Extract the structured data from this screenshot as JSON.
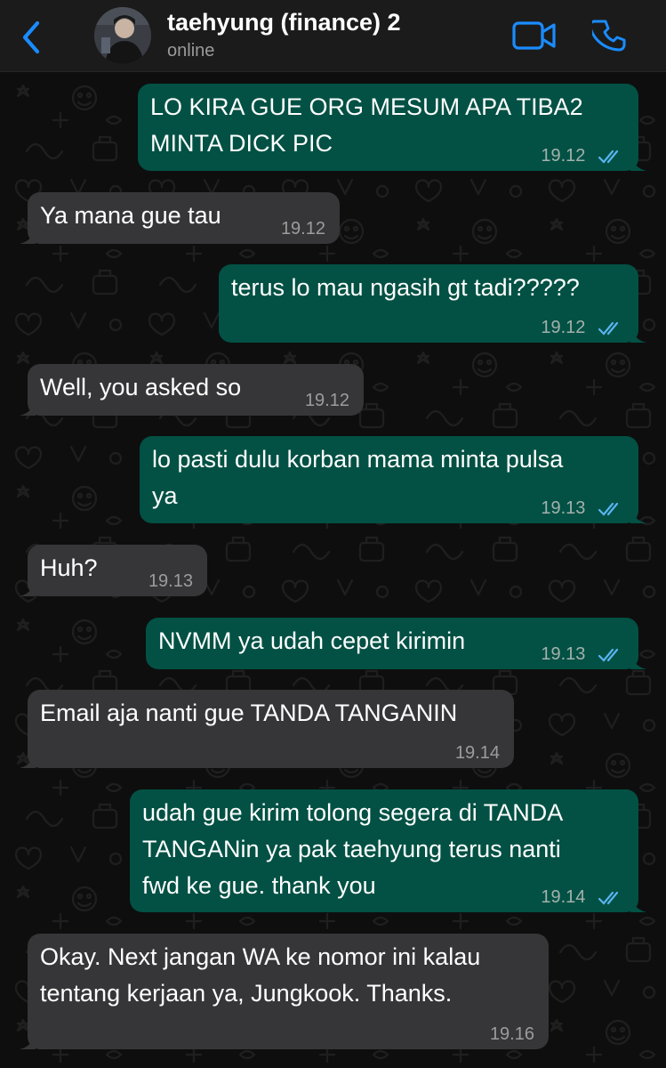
{
  "header": {
    "back_icon": "chevron-left-icon",
    "contact_name": "taehyung (finance) 2",
    "status": "online",
    "video_icon": "video-camera-icon",
    "call_icon": "phone-icon",
    "accent_color": "#1a8cff"
  },
  "messages": [
    {
      "direction": "out",
      "text": "LO KIRA GUE ORG MESUM APA TIBA2\nMINTA DICK PIC",
      "time": "19.12",
      "read": true
    },
    {
      "direction": "in",
      "text": "Ya mana gue tau",
      "time": "19.12"
    },
    {
      "direction": "out",
      "text": "terus lo mau ngasih gt tadi?????",
      "time": "19.12",
      "read": true
    },
    {
      "direction": "in",
      "text": "Well, you asked so",
      "time": "19.12"
    },
    {
      "direction": "out",
      "text": "lo pasti dulu korban mama minta pulsa\nya",
      "time": "19.13",
      "read": true
    },
    {
      "direction": "in",
      "text": "Huh?",
      "time": "19.13"
    },
    {
      "direction": "out",
      "text": "NVMM ya udah cepet kirimin",
      "time": "19.13",
      "read": true
    },
    {
      "direction": "in",
      "text": "Email aja nanti gue TANDA TANGANIN",
      "time": "19.14"
    },
    {
      "direction": "out",
      "text": "udah gue kirim tolong segera di TANDA\nTANGANin ya pak taehyung terus nanti\nfwd ke gue. thank you",
      "time": "19.14",
      "read": true
    },
    {
      "direction": "in",
      "text": "Okay. Next jangan WA ke nomor ini kalau\ntentang kerjaan ya, Jungkook. Thanks.",
      "time": "19.16"
    }
  ],
  "colors": {
    "outgoing_bubble": "#025144",
    "incoming_bubble": "#363638",
    "read_ticks": "#5ab4f0"
  }
}
